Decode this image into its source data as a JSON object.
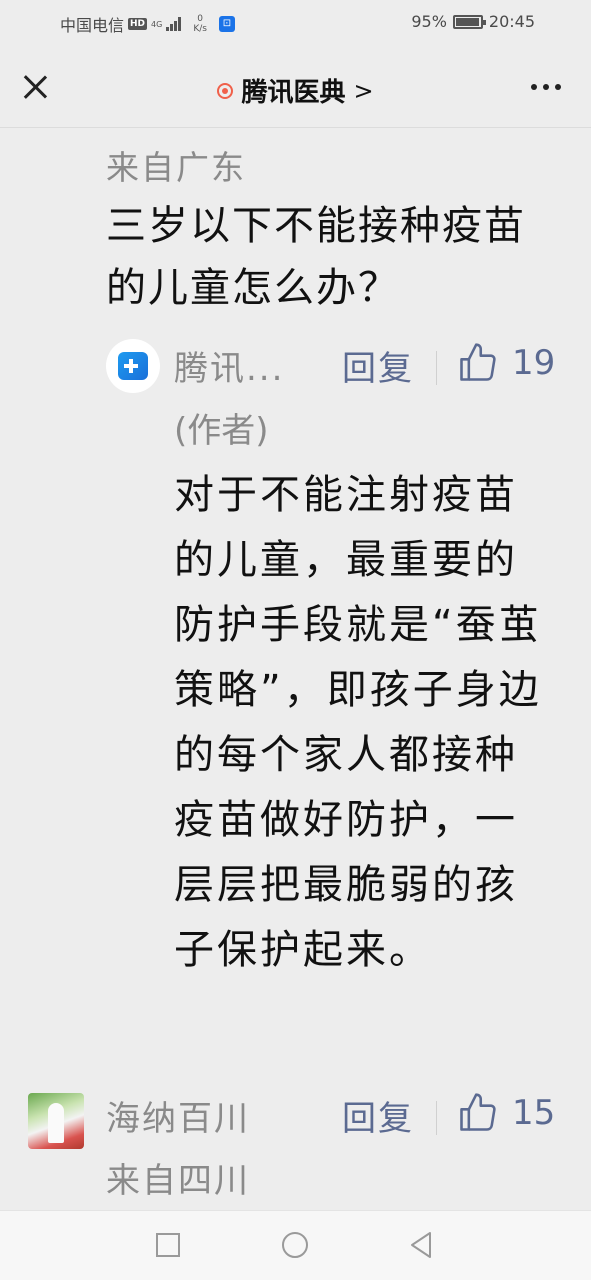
{
  "status_bar": {
    "carrier": "中国电信",
    "hd": "HD",
    "network": "4G",
    "speed_value": "0",
    "speed_unit": "K/s",
    "battery": "95%",
    "battery_level": 0.95,
    "time": "20:45"
  },
  "title_bar": {
    "title": "腾讯医典",
    "chevron": ">"
  },
  "top_comment": {
    "location": "来自广东",
    "text": "三岁以下不能接种疫苗的儿童怎么办？"
  },
  "reply": {
    "author": "腾讯...",
    "author_role": "(作者)",
    "reply_label": "回复",
    "likes": "19",
    "text": "对于不能注射疫苗的儿童，最重要的防护手段就是“蚕茧策略”，即孩子身边的每个家人都接种疫苗做好防护，一层层把最脆弱的孩子保护起来。"
  },
  "comment2": {
    "author": "海纳百川",
    "reply_label": "回复",
    "likes": "15",
    "location": "来自四川"
  },
  "icons": {
    "close": "close-icon",
    "more": "more-icon",
    "like": "thumbs-up-icon"
  },
  "colors": {
    "background": "#ededed",
    "link": "#5b6a91",
    "muted": "#8a8a8a",
    "live_dot": "#f0604a"
  }
}
